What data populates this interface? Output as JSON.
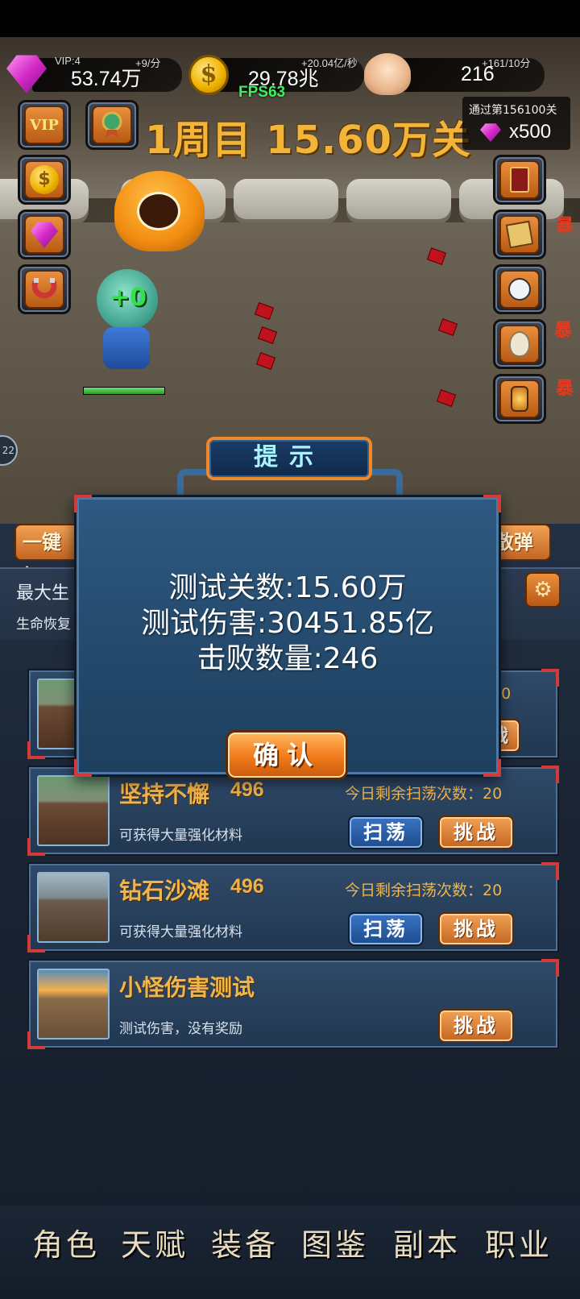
{
  "resources": {
    "gems": {
      "vip": "VIP:4",
      "rate": "+9/分",
      "value": "53.74万"
    },
    "coins": {
      "rate": "+20.04亿/秒",
      "value": "29.78兆",
      "symbol": "$"
    },
    "skulls": {
      "rate": "+161/10分",
      "value": "216"
    }
  },
  "fps": "FPS63",
  "stage_title": "1周目 15.60万关",
  "pass_reward": {
    "label": "通过第156100关",
    "count": "x500"
  },
  "side_left": [
    {
      "name": "vip-button",
      "label": "VIP"
    },
    {
      "name": "medal-button",
      "label": ""
    },
    {
      "name": "coin-shop-button",
      "label": "$"
    },
    {
      "name": "gem-shop-button",
      "label": ""
    },
    {
      "name": "magnet-button",
      "label": ""
    }
  ],
  "side_right": [
    {
      "name": "card-button",
      "label": ""
    },
    {
      "name": "cards-button",
      "label": ""
    },
    {
      "name": "robot-button",
      "label": ""
    },
    {
      "name": "egg-button",
      "label": ""
    },
    {
      "name": "lantern-button",
      "label": ""
    }
  ],
  "crit_text": "暴",
  "hero_popup": "+0",
  "hero_hp_fraction": 1.0,
  "left_orb": "22",
  "lower": {
    "one_key_label": "一键加",
    "scatter_label": "散弹",
    "max_hp_label": "最大生",
    "regen_label": "生命恢复",
    "settings_icon": "⚙"
  },
  "dungeons": [
    {
      "name": "",
      "level": "",
      "desc": "",
      "remaining": "20",
      "buttons": [
        "战"
      ]
    },
    {
      "name": "坚持不懈",
      "level": "496",
      "desc": "可获得大量强化材料",
      "remaining": "今日剩余扫荡次数：20",
      "sweep": "扫荡",
      "challenge": "挑战"
    },
    {
      "name": "钻石沙滩",
      "level": "496",
      "desc": "可获得大量强化材料",
      "remaining": "今日剩余扫荡次数：20",
      "sweep": "扫荡",
      "challenge": "挑战"
    },
    {
      "name": "小怪伤害测试",
      "level": "",
      "desc": "测试伤害，没有奖励",
      "remaining": "",
      "challenge": "挑战"
    }
  ],
  "dialog": {
    "title": "提示",
    "lines": [
      "测试关数:15.60万",
      "测试伤害:30451.85亿",
      "击败数量:246"
    ],
    "confirm": "确认"
  },
  "bottom_nav": [
    "角色",
    "天赋",
    "装备",
    "图鉴",
    "副本",
    "职业"
  ]
}
